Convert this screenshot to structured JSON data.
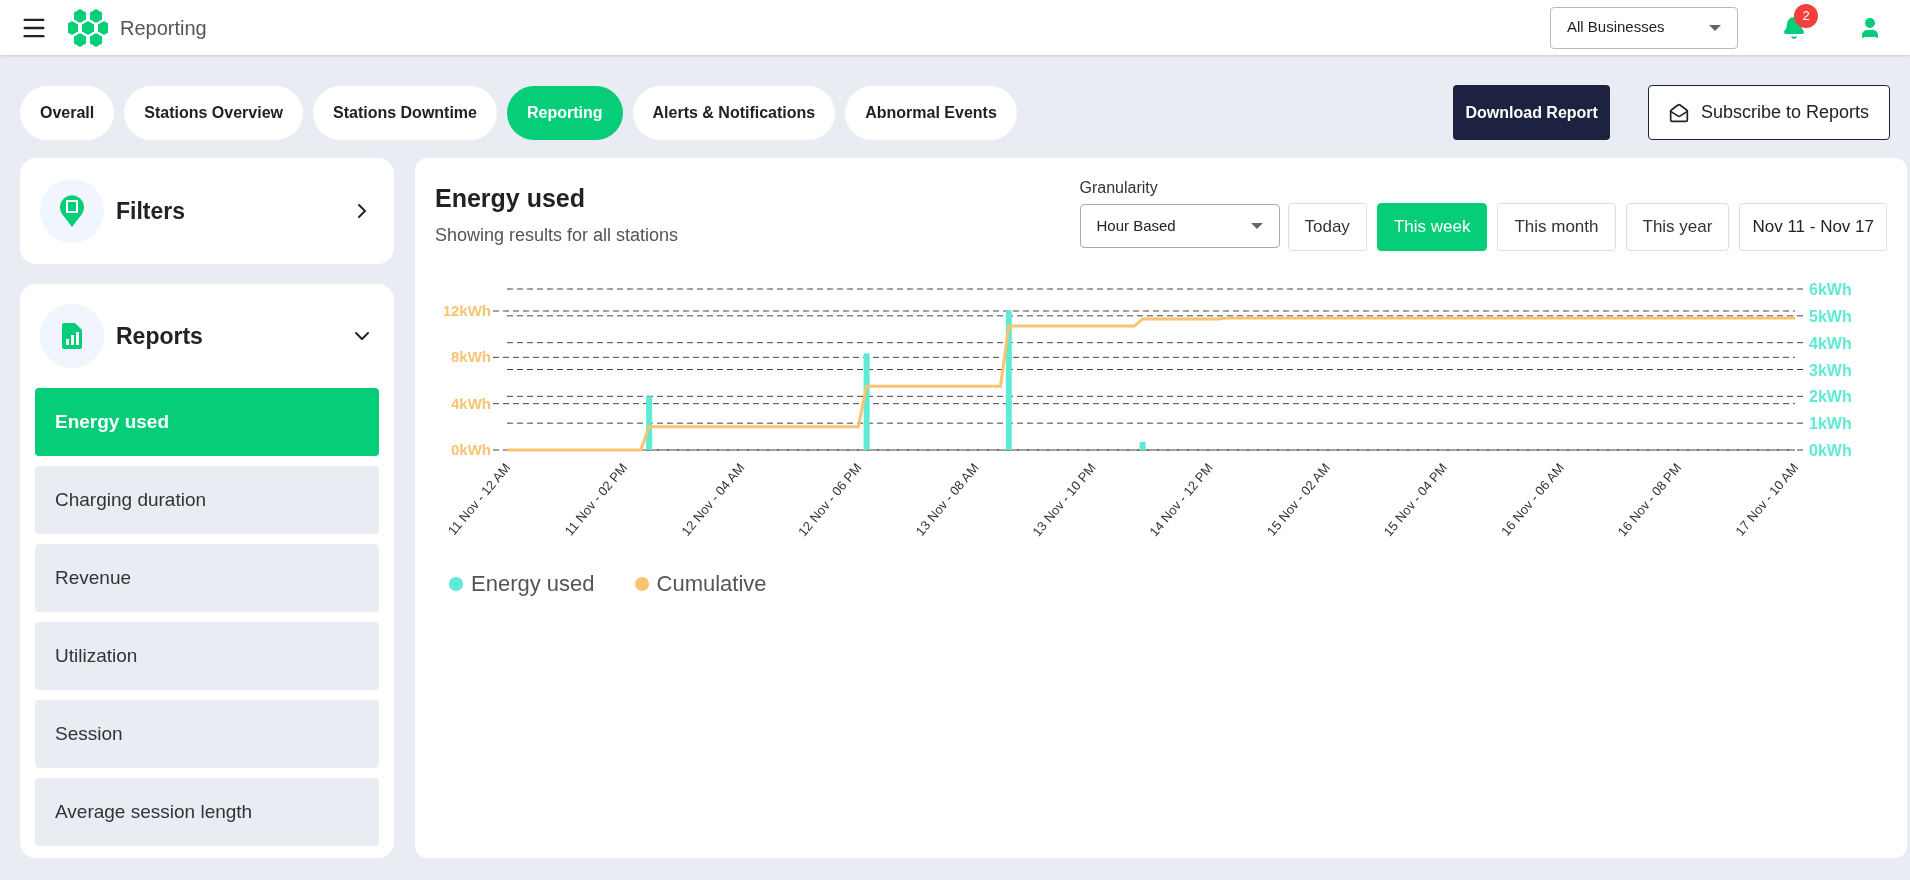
{
  "header": {
    "title": "Reporting",
    "business_select": {
      "value": "All Businesses"
    },
    "notifications": {
      "count": "2"
    }
  },
  "tabs": [
    {
      "label": "Overall",
      "selected": false
    },
    {
      "label": "Stations Overview",
      "selected": false
    },
    {
      "label": "Stations Downtime",
      "selected": false
    },
    {
      "label": "Reporting",
      "selected": true
    },
    {
      "label": "Alerts & Notifications",
      "selected": false
    },
    {
      "label": "Abnormal Events",
      "selected": false
    }
  ],
  "actions": {
    "download": "Download Report",
    "subscribe": "Subscribe to Reports"
  },
  "sidebar": {
    "filters": {
      "title": "Filters",
      "expanded": false
    },
    "reports": {
      "title": "Reports",
      "expanded": true,
      "items": [
        {
          "label": "Energy used",
          "selected": true
        },
        {
          "label": "Charging duration",
          "selected": false
        },
        {
          "label": "Revenue",
          "selected": false
        },
        {
          "label": "Utilization",
          "selected": false
        },
        {
          "label": "Session",
          "selected": false
        },
        {
          "label": "Average session length",
          "selected": false
        }
      ]
    }
  },
  "panel": {
    "title": "Energy used",
    "subtitle": "Showing results for all stations",
    "granularity": {
      "label": "Granularity",
      "value": "Hour Based"
    },
    "periods": [
      {
        "label": "Today",
        "selected": false
      },
      {
        "label": "This week",
        "selected": true
      },
      {
        "label": "This month",
        "selected": false
      },
      {
        "label": "This year",
        "selected": false
      }
    ],
    "date_range": "Nov 11 - Nov 17",
    "chart_data": {
      "type": "bar",
      "grid": true,
      "categories": [
        "11 Nov - 12 AM",
        null,
        null,
        null,
        null,
        null,
        null,
        null,
        null,
        null,
        null,
        null,
        null,
        null,
        "11 Nov - 02 PM",
        null,
        null,
        null,
        null,
        null,
        null,
        null,
        null,
        null,
        null,
        null,
        null,
        null,
        "12 Nov - 04 AM",
        null,
        null,
        null,
        null,
        null,
        null,
        null,
        null,
        null,
        null,
        null,
        null,
        null,
        "12 Nov - 06 PM",
        null,
        null,
        null,
        null,
        null,
        null,
        null,
        null,
        null,
        null,
        null,
        null,
        null,
        "13 Nov - 08 AM",
        null,
        null,
        null,
        null,
        null,
        null,
        null,
        null,
        null,
        null,
        null,
        null,
        null,
        "13 Nov - 10 PM",
        null,
        null,
        null,
        null,
        null,
        null,
        null,
        null,
        null,
        null,
        null,
        null,
        null,
        "14 Nov - 12 PM",
        null,
        null,
        null,
        null,
        null,
        null,
        null,
        null,
        null,
        null,
        null,
        null,
        null,
        "15 Nov - 02 AM",
        null,
        null,
        null,
        null,
        null,
        null,
        null,
        null,
        null,
        null,
        null,
        null,
        null,
        "15 Nov - 04 PM",
        null,
        null,
        null,
        null,
        null,
        null,
        null,
        null,
        null,
        null,
        null,
        null,
        null,
        "16 Nov - 06 AM",
        null,
        null,
        null,
        null,
        null,
        null,
        null,
        null,
        null,
        null,
        null,
        null,
        null,
        "16 Nov - 08 PM",
        null,
        null,
        null,
        null,
        null,
        null,
        null,
        null,
        null,
        null,
        null,
        null,
        null,
        "17 Nov - 10 AM"
      ],
      "series": [
        {
          "name": "Energy used",
          "type": "bar",
          "color": "#5eead4",
          "axis": "y2",
          "values": [
            null,
            null,
            null,
            null,
            null,
            null,
            null,
            null,
            null,
            null,
            null,
            null,
            null,
            null,
            null,
            null,
            null,
            2.0,
            null,
            null,
            null,
            null,
            null,
            null,
            null,
            null,
            null,
            null,
            null,
            null,
            null,
            null,
            null,
            null,
            null,
            null,
            null,
            null,
            null,
            null,
            null,
            null,
            null,
            3.6,
            null,
            null,
            null,
            null,
            null,
            null,
            null,
            null,
            null,
            null,
            null,
            null,
            null,
            null,
            null,
            null,
            5.2,
            null,
            null,
            null,
            null,
            null,
            null,
            null,
            null,
            null,
            null,
            null,
            null,
            null,
            null,
            null,
            0.3,
            null,
            null,
            null,
            null,
            null,
            null,
            null,
            null,
            null,
            null,
            null,
            null,
            null,
            null,
            null,
            null,
            null,
            null,
            null,
            null,
            null,
            null,
            null,
            null,
            null,
            null,
            null,
            null,
            null,
            null,
            null,
            null,
            null,
            null,
            null,
            null,
            null,
            null,
            null,
            null,
            null,
            null,
            null,
            null,
            null,
            null,
            null,
            null,
            null,
            null,
            null,
            null,
            null,
            null,
            null,
            null,
            null,
            null,
            null,
            null,
            null,
            null,
            null,
            null,
            null,
            null,
            null,
            null,
            null,
            null,
            null,
            null,
            null,
            null,
            null,
            null,
            null,
            null
          ]
        },
        {
          "name": "Cumulative",
          "type": "line",
          "color": "#f8c471",
          "values": [
            0,
            0,
            0,
            0,
            0,
            0,
            0,
            0,
            0,
            0,
            0,
            0,
            0,
            0,
            0,
            0,
            0,
            2.0,
            2.0,
            2.0,
            2.0,
            2.0,
            2.0,
            2.0,
            2.0,
            2.0,
            2.0,
            2.0,
            2.0,
            2.0,
            2.0,
            2.0,
            2.0,
            2.0,
            2.0,
            2.0,
            2.0,
            2.0,
            2.0,
            2.0,
            2.0,
            2.0,
            2.0,
            5.5,
            5.5,
            5.5,
            5.5,
            5.5,
            5.5,
            5.5,
            5.5,
            5.5,
            5.5,
            5.5,
            5.5,
            5.5,
            5.5,
            5.5,
            5.5,
            5.5,
            10.7,
            10.7,
            10.7,
            10.7,
            10.7,
            10.7,
            10.7,
            10.7,
            10.7,
            10.7,
            10.7,
            10.7,
            10.7,
            10.7,
            10.7,
            10.7,
            11.3,
            11.3,
            11.3,
            11.3,
            11.3,
            11.3,
            11.3,
            11.3,
            11.3,
            11.3,
            11.4,
            11.4,
            11.4,
            11.4,
            11.4,
            11.4,
            11.4,
            11.4,
            11.4,
            11.4,
            11.4,
            11.4,
            11.4,
            11.4,
            11.4,
            11.4,
            11.4,
            11.4,
            11.4,
            11.4,
            11.4,
            11.4,
            11.4,
            11.4,
            11.4,
            11.4,
            11.4,
            11.4,
            11.4,
            11.4,
            11.4,
            11.4,
            11.4,
            11.4,
            11.4,
            11.4,
            11.4,
            11.4,
            11.4,
            11.4,
            11.4,
            11.4,
            11.4,
            11.4,
            11.4,
            11.4,
            11.4,
            11.4,
            11.4,
            11.4,
            11.4,
            11.4,
            11.4,
            11.4,
            11.4,
            11.4,
            11.4,
            11.4,
            11.4,
            11.4,
            11.4,
            11.4,
            11.4,
            11.4,
            11.4,
            11.4,
            11.4,
            11.4,
            11.4
          ]
        }
      ],
      "ylim": [
        0,
        13.9
      ],
      "y2lim": [
        0,
        6
      ],
      "yticks": [
        {
          "value": 0,
          "label": "0kWh"
        },
        {
          "value": 4,
          "label": "4kWh"
        },
        {
          "value": 8,
          "label": "8kWh"
        },
        {
          "value": 12,
          "label": "12kWh"
        }
      ],
      "y2ticks": [
        {
          "value": 0,
          "label": "0kWh"
        },
        {
          "value": 1,
          "label": "1kWh"
        },
        {
          "value": 2,
          "label": "2kWh"
        },
        {
          "value": 3,
          "label": "3kWh"
        },
        {
          "value": 4,
          "label": "4kWh"
        },
        {
          "value": 5,
          "label": "5kWh"
        },
        {
          "value": 6,
          "label": "6kWh"
        }
      ]
    }
  }
}
